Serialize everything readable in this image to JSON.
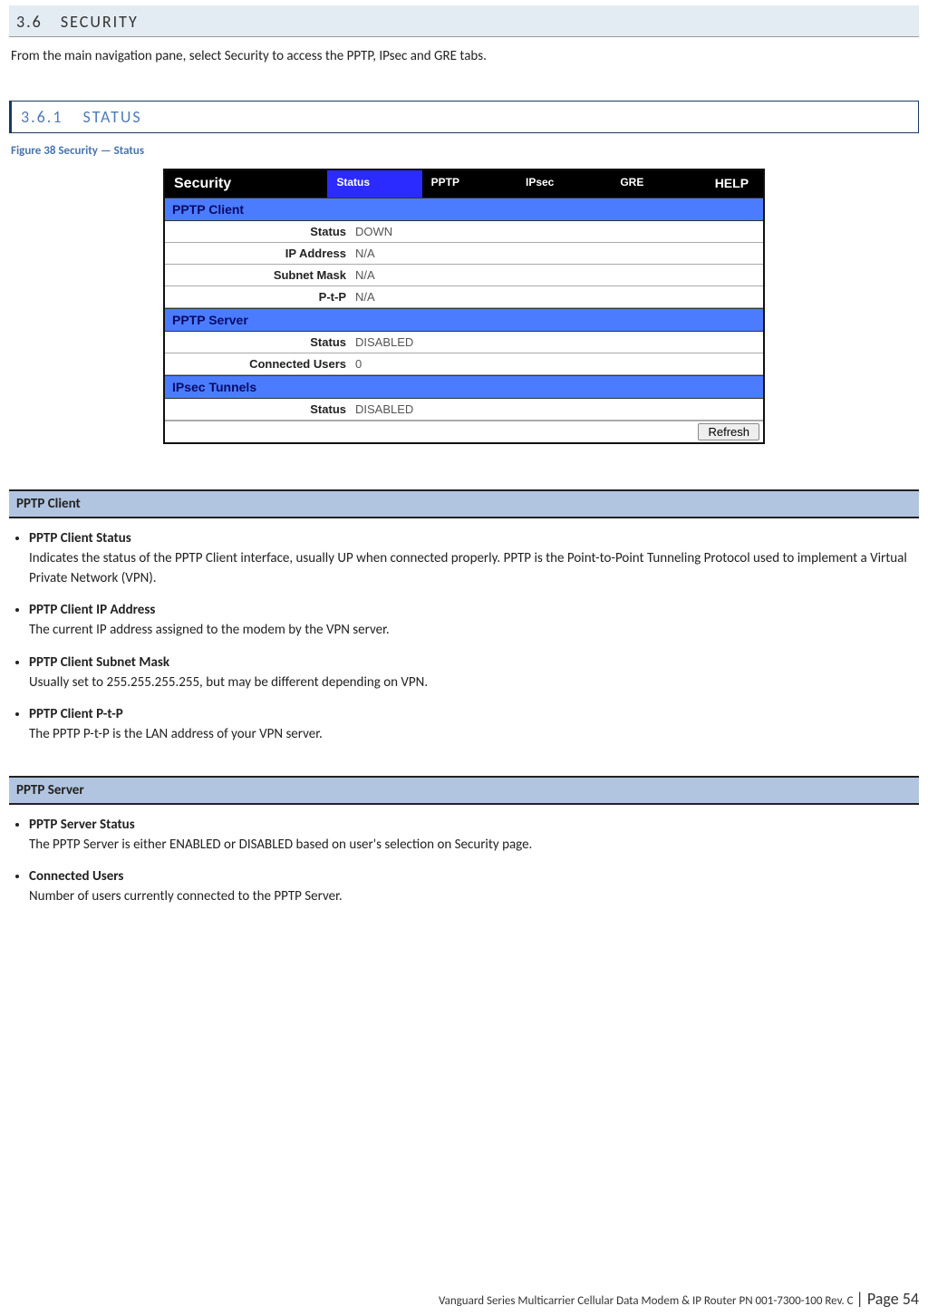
{
  "section": {
    "number": "3.6",
    "title": "SECURITY",
    "intro": "From the main navigation pane, select Security to access the PPTP, IPsec and GRE tabs."
  },
  "subsection": {
    "number": "3.6.1",
    "title": "STATUS"
  },
  "figure_caption": "Figure 38 Security — Status",
  "panel": {
    "title": "Security",
    "tabs": [
      "Status",
      "PPTP",
      "IPsec",
      "GRE"
    ],
    "help": "HELP",
    "pptp_client": {
      "heading": "PPTP Client",
      "status_label": "Status",
      "status_value": "DOWN",
      "ip_label": "IP Address",
      "ip_value": "N/A",
      "mask_label": "Subnet Mask",
      "mask_value": "N/A",
      "ptp_label": "P-t-P",
      "ptp_value": "N/A"
    },
    "pptp_server": {
      "heading": "PPTP Server",
      "status_label": "Status",
      "status_value": "DISABLED",
      "users_label": "Connected Users",
      "users_value": "0"
    },
    "ipsec": {
      "heading": "IPsec Tunnels",
      "status_label": "Status",
      "status_value": "DISABLED"
    },
    "refresh_label": "Refresh"
  },
  "pptp_client_section": {
    "heading": "PPTP Client",
    "items": [
      {
        "term": "PPTP Client Status",
        "desc": "Indicates the status of the PPTP Client interface, usually UP when connected properly. PPTP is the Point-to-Point Tunneling Protocol used to implement a Virtual Private Network (VPN)."
      },
      {
        "term": "PPTP Client IP Address",
        "desc": "The current IP address assigned to the modem by the VPN server."
      },
      {
        "term": "PPTP Client Subnet Mask",
        "desc": "Usually set to 255.255.255.255, but may be different depending on VPN."
      },
      {
        "term": "PPTP Client P-t-P",
        "desc": "The PPTP P-t-P is the LAN address of your VPN server."
      }
    ]
  },
  "pptp_server_section": {
    "heading": "PPTP Server",
    "items": [
      {
        "term": "PPTP Server Status",
        "desc": "The PPTP Server is either ENABLED or DISABLED based on user's selection on Security page."
      },
      {
        "term": "Connected Users",
        "desc": "Number of users currently connected to the PPTP Server."
      }
    ]
  },
  "footer": {
    "text": "Vanguard Series Multicarrier Cellular Data Modem & IP Router PN 001-7300-100 Rev. C",
    "page": " | Page 54"
  }
}
